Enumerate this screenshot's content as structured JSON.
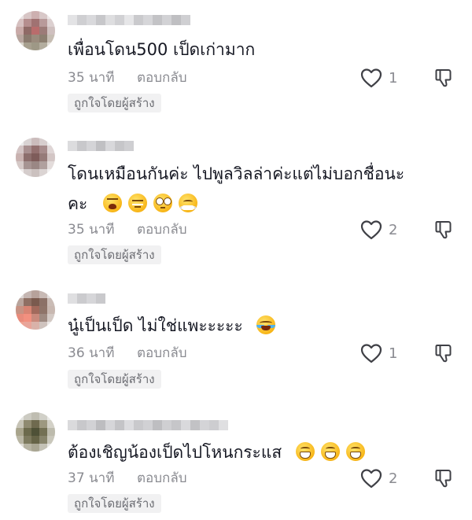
{
  "comments": [
    {
      "text": "เพื่อนโดน500  เป็ดเก่ามาก",
      "text_line2": "",
      "emojis": [],
      "emojis_line2": [],
      "time": "35 นาที",
      "reply_label": "ตอบกลับ",
      "likes": "1",
      "badge": "ถูกใจโดยผู้สร้าง"
    },
    {
      "text": "โดนเหมือนกันค่ะ ไปพูลวิลล่าค่ะแต่ไม่บอกชื่อนะ",
      "text_line2": "คะ",
      "emojis": [],
      "emojis_line2": [
        "weary-face-emoji",
        "unamused-face-emoji",
        "rolling-eyes-emoji",
        "steam-nose-face-emoji"
      ],
      "time": "35 นาที",
      "reply_label": "ตอบกลับ",
      "likes": "2",
      "badge": "ถูกใจโดยผู้สร้าง"
    },
    {
      "text": "นู๋เป็นเป็ด ไม่ใช่แพะะะะะ",
      "text_line2": "",
      "emojis": [
        "tears-of-joy-emoji"
      ],
      "emojis_line2": [],
      "time": "36 นาที",
      "reply_label": "ตอบกลับ",
      "likes": "1",
      "badge": "ถูกใจโดยผู้สร้าง"
    },
    {
      "text": "ต้องเชิญน้องเป็ดไปโหนกระแส",
      "text_line2": "",
      "emojis": [
        "grinning-face-emoji",
        "grinning-face-emoji",
        "grinning-face-emoji"
      ],
      "emojis_line2": [],
      "time": "37 นาที",
      "reply_label": "ตอบกลับ",
      "likes": "2",
      "badge": "ถูกใจโดยผู้สร้าง"
    }
  ],
  "icons": {
    "like": "heart-outline-icon",
    "dislike": "thumbs-down-outline-icon"
  },
  "colors": {
    "text": "#161823",
    "meta": "#8a8b91",
    "badge_bg": "#f1f1f2"
  }
}
